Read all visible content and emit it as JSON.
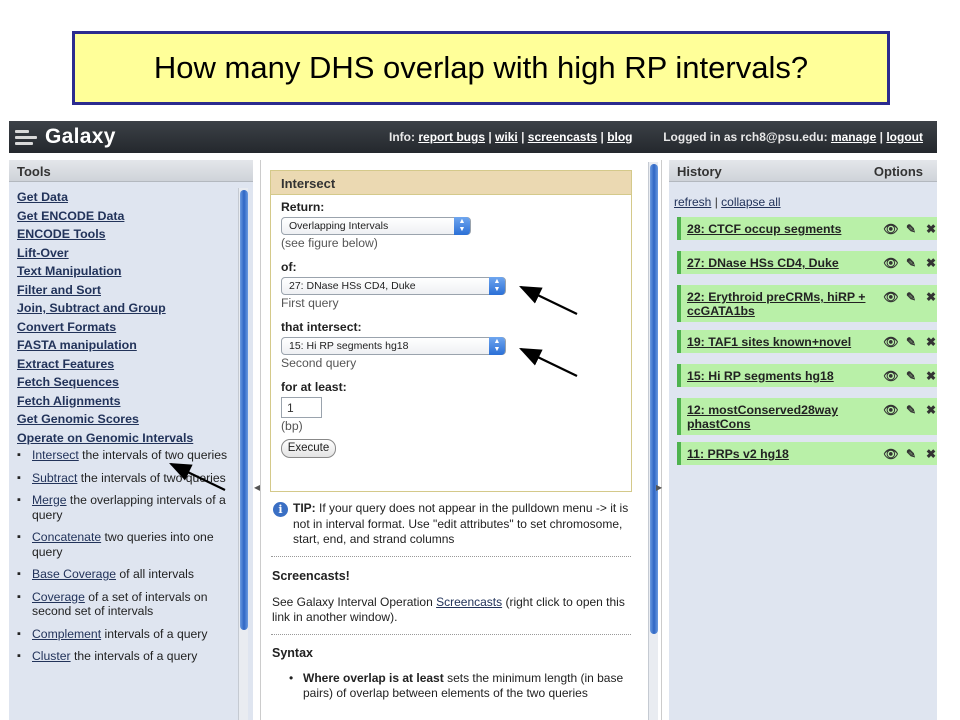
{
  "slide": {
    "title": "How many DHS overlap with high RP intervals?"
  },
  "masthead": {
    "brand": "Galaxy",
    "info_label": "Info:",
    "links": [
      "report bugs",
      "wiki",
      "screencasts",
      "blog"
    ],
    "logged_in_text": "Logged in as rch8@psu.edu:",
    "user_links": [
      "manage",
      "logout"
    ]
  },
  "tools": {
    "title": "Tools",
    "sections": [
      "Get Data",
      "Get ENCODE Data",
      "ENCODE Tools",
      "Lift-Over",
      "Text Manipulation",
      "Filter and Sort",
      "Join, Subtract and Group",
      "Convert Formats",
      "FASTA manipulation",
      "Extract Features",
      "Fetch Sequences",
      "Fetch Alignments",
      "Get Genomic Scores",
      "Operate on Genomic Intervals"
    ],
    "subtools": [
      {
        "link": "Intersect",
        "text": " the intervals of two queries"
      },
      {
        "link": "Subtract",
        "text": " the intervals of two queries"
      },
      {
        "link": "Merge",
        "text": " the overlapping intervals of a query"
      },
      {
        "link": "Concatenate",
        "text": " two queries into one query"
      },
      {
        "link": "Base Coverage",
        "text": " of all intervals"
      },
      {
        "link": "Coverage",
        "text": " of a set of intervals on second set of intervals"
      },
      {
        "link": "Complement",
        "text": " intervals of a query"
      },
      {
        "link": "Cluster",
        "text": " the intervals of a query"
      }
    ]
  },
  "form": {
    "title": "Intersect",
    "return_label": "Return:",
    "return_value": "Overlapping Intervals",
    "return_hint": "(see figure below)",
    "of_label": "of:",
    "of_value": "27: DNase HSs CD4, Duke",
    "of_hint": "First query",
    "intersect_label": "that intersect:",
    "intersect_value": "15: Hi RP segments hg18",
    "intersect_hint": "Second query",
    "atleast_label": "for at least:",
    "atleast_value": "1",
    "atleast_hint": "(bp)",
    "execute_label": "Execute"
  },
  "tip": {
    "label": "TIP:",
    "text": " If your query does not appear in the pulldown menu -> it is not in interval format. Use \"edit attributes\" to set chromosome, start, end, and strand columns"
  },
  "screencasts": {
    "title": "Screencasts!",
    "text_before": "See Galaxy Interval Operation ",
    "link": "Screencasts",
    "text_after": " (right click to open this link in another window)."
  },
  "syntax": {
    "title": "Syntax",
    "bold": "Where overlap is at least",
    "text": " sets the minimum length (in base pairs) of overlap between elements of the two queries"
  },
  "history": {
    "title": "History",
    "options_label": "Options",
    "refresh_link": "refresh",
    "collapse_link": "collapse all",
    "items": [
      "28: CTCF occup segments",
      "27: DNase HSs CD4, Duke",
      "22: Erythroid preCRMs, hiRP + ccGATA1bs",
      "19: TAF1 sites known+novel",
      "15: Hi RP segments hg18",
      "12: mostConserved28way phastCons",
      "11: PRPs v2 hg18"
    ],
    "item_icons": [
      "eye-icon",
      "pencil-icon",
      "delete-icon"
    ]
  },
  "colors": {
    "title_bg": "#ffff99",
    "title_border": "#2b2b8f",
    "masthead": "#2d3136",
    "history_item_bg": "#b9f0a8",
    "form_header": "#ebd9b2",
    "panel_bg": "#dfe5f0"
  }
}
